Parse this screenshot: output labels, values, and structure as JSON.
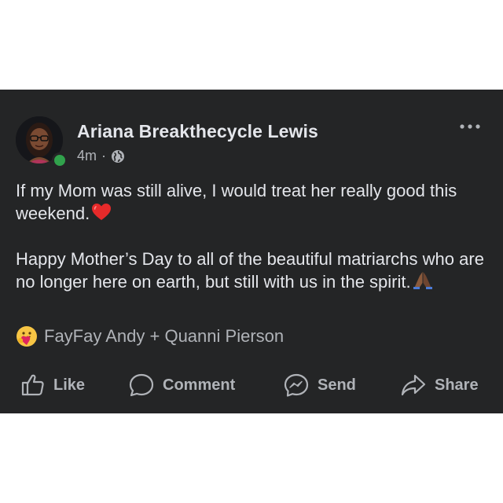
{
  "post": {
    "author_name": "Ariana Breakthecycle Lewis",
    "timestamp": "4m",
    "separator": "·",
    "privacy_icon": "globe-icon",
    "more_icon": "more-options-icon",
    "online": true,
    "paragraphs": [
      {
        "text": "If my Mom was still alive, I would treat her really good this weekend.",
        "emoji": "red-heart-icon"
      },
      {
        "text": "Happy Mother’s Day to all of the beautiful matriarchs who are no longer here on earth, but still with us in the spirit.",
        "emoji": "folded-hands-icon"
      }
    ],
    "reactions": {
      "icon": "care-reaction-icon",
      "text": "FayFay Andy + Quanni Pierson"
    }
  },
  "actions": {
    "like_label": "Like",
    "comment_label": "Comment",
    "send_label": "Send",
    "share_label": "Share"
  },
  "colors": {
    "card_background": "#242526",
    "primary_text": "#e4e6eb",
    "secondary_text": "#b0b3b8",
    "online_dot": "#31a24c"
  }
}
